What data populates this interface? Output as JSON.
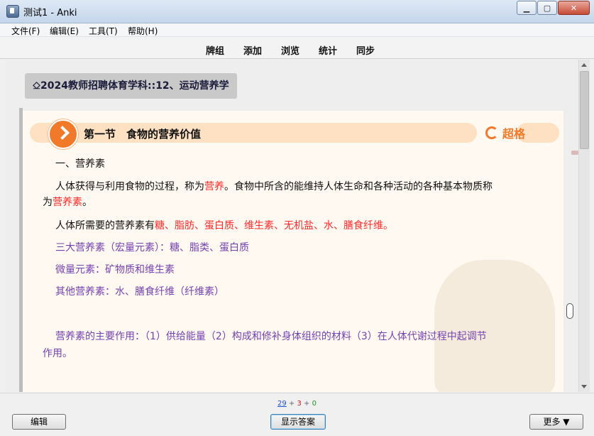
{
  "window": {
    "title": "测试1 - Anki"
  },
  "menu": [
    "文件(F)",
    "编辑(E)",
    "工具(T)",
    "帮助(H)"
  ],
  "toolbar": [
    "牌组",
    "添加",
    "浏览",
    "统计",
    "同步"
  ],
  "card": {
    "deck_label": "⎐2024教师招聘体育学科::12、运动营养学",
    "section_title": "第一节　食物的营养价值",
    "brand": "超格",
    "heading": "一、营养素",
    "p1_a": "人体获得与利用食物的过程，称为",
    "p1_b": "营养",
    "p1_c": "。食物中所含的能维持人体生命和各种活动的各种基本物质称",
    "p1_d": "为",
    "p1_e": "营养素",
    "p1_f": "。",
    "p2_a": "人体所需要的营养素有",
    "p2_b": "糖、脂肪、蛋白质、维生素、无机盐、水、膳食纤维。",
    "line_macro": "三大营养素（宏量元素）：糖、脂类、蛋白质",
    "line_micro": "微量元素：矿物质和维生素",
    "line_other": "其他营养素：水、膳食纤维（纤维素）",
    "func_1": "营养素的主要作用：（1）供给能量（2）构成和修补身体组织的材料（3）在人体代谢过程中起调节",
    "func_2": "作用。"
  },
  "counts": {
    "new": "29",
    "plus": "+",
    "learn": "3",
    "review": "0"
  },
  "buttons": {
    "edit": "编辑",
    "show_answer": "显示答案",
    "more": "更多 ▼"
  },
  "window_controls": {
    "minimize": "▁",
    "maximize": "▢",
    "close": "✕"
  }
}
